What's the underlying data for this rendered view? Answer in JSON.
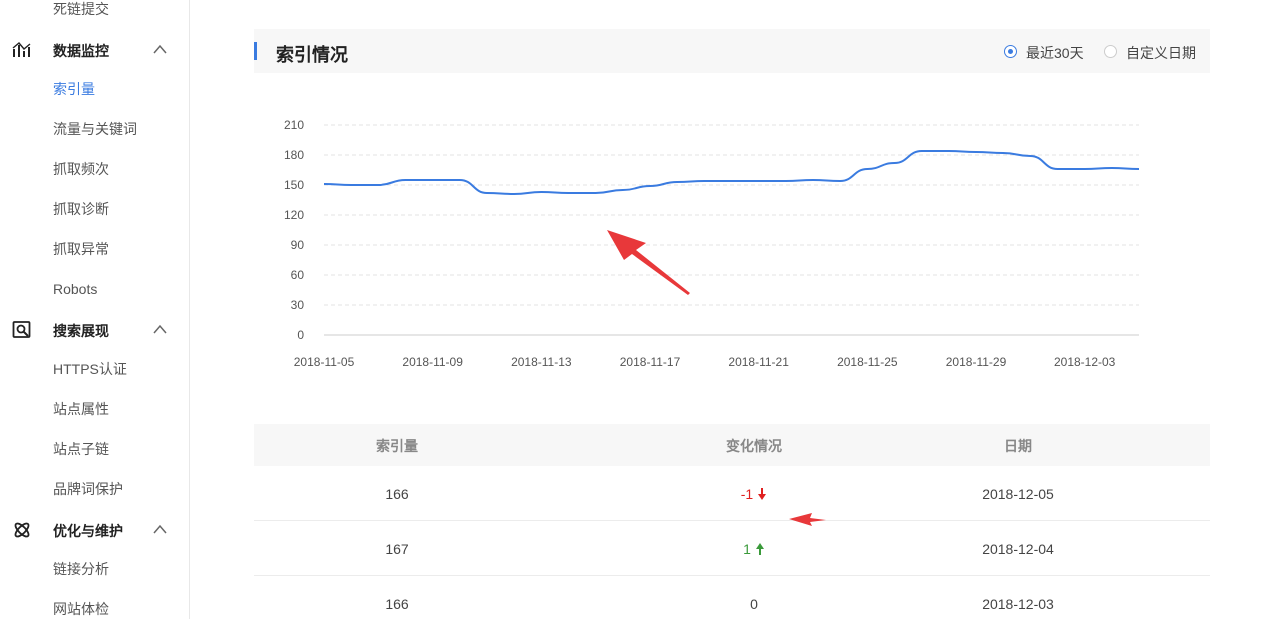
{
  "sidebar": {
    "top_item": "死链提交",
    "sections": [
      {
        "title": "数据监控",
        "icon": "chart-monitor-icon",
        "items": [
          "索引量",
          "流量与关键词",
          "抓取频次",
          "抓取诊断",
          "抓取异常",
          "Robots"
        ]
      },
      {
        "title": "搜索展现",
        "icon": "search-display-icon",
        "items": [
          "HTTPS认证",
          "站点属性",
          "站点子链",
          "品牌词保护"
        ]
      },
      {
        "title": "优化与维护",
        "icon": "atom-icon",
        "items": [
          "链接分析",
          "网站体检"
        ]
      }
    ],
    "active_item": "索引量"
  },
  "panel": {
    "title": "索引情况",
    "radio_recent": "最近30天",
    "radio_custom": "自定义日期"
  },
  "chart_data": {
    "type": "line",
    "x_tick_labels": [
      "2018-11-05",
      "2018-11-09",
      "2018-11-13",
      "2018-11-17",
      "2018-11-21",
      "2018-11-25",
      "2018-11-29",
      "2018-12-03"
    ],
    "y_ticks": [
      0,
      30,
      60,
      90,
      120,
      150,
      180,
      210
    ],
    "ylim": [
      0,
      210
    ],
    "grid": true,
    "x": [
      "2018-11-05",
      "2018-11-06",
      "2018-11-07",
      "2018-11-08",
      "2018-11-09",
      "2018-11-10",
      "2018-11-11",
      "2018-11-12",
      "2018-11-13",
      "2018-11-14",
      "2018-11-15",
      "2018-11-16",
      "2018-11-17",
      "2018-11-18",
      "2018-11-19",
      "2018-11-20",
      "2018-11-21",
      "2018-11-22",
      "2018-11-23",
      "2018-11-24",
      "2018-11-25",
      "2018-11-26",
      "2018-11-27",
      "2018-11-28",
      "2018-11-29",
      "2018-11-30",
      "2018-12-01",
      "2018-12-02",
      "2018-12-03",
      "2018-12-04",
      "2018-12-05"
    ],
    "series": [
      {
        "values": [
          151,
          150,
          150,
          155,
          155,
          155,
          142,
          141,
          143,
          142,
          142,
          145,
          149,
          153,
          154,
          154,
          154,
          154,
          155,
          154,
          166,
          172,
          184,
          184,
          183,
          182,
          179,
          166,
          166,
          167,
          166
        ]
      }
    ],
    "color": "#3a7be0"
  },
  "table": {
    "headers": [
      "索引量",
      "变化情况",
      "日期"
    ],
    "rows": [
      {
        "count": "166",
        "change": "-1",
        "direction": "down",
        "date": "2018-12-05"
      },
      {
        "count": "167",
        "change": "1",
        "direction": "up",
        "date": "2018-12-04"
      },
      {
        "count": "166",
        "change": "0",
        "direction": "none",
        "date": "2018-12-03"
      }
    ]
  },
  "colors": {
    "accent": "#3a7be0",
    "down": "#e02020",
    "up": "#3a9a3a",
    "annotation": "#e8383a"
  }
}
